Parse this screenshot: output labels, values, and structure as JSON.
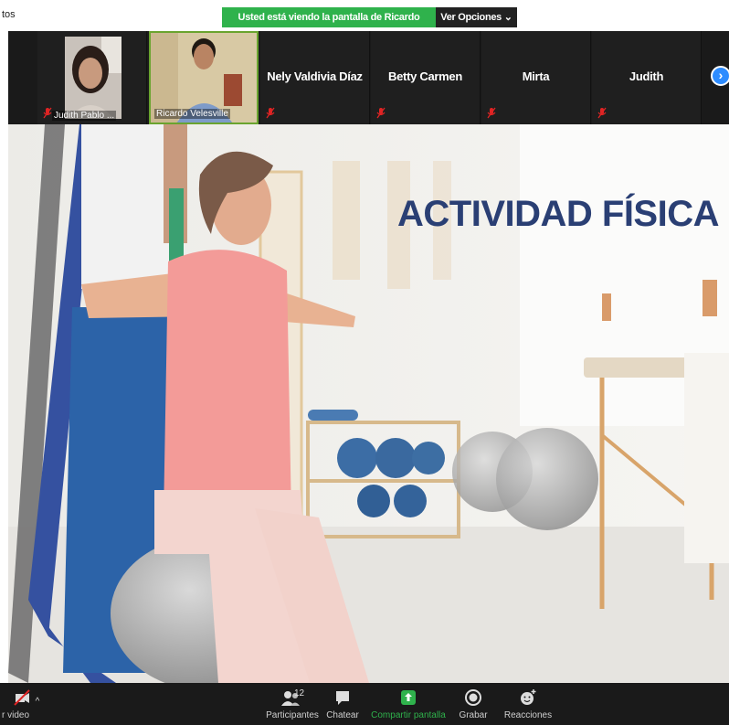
{
  "topbar": {
    "left_text": "tos",
    "share_banner": "Usted está viendo la pantalla de Ricardo Velesville",
    "options_button": "Ver Opciones ⌄"
  },
  "participants": [
    {
      "name": "Judith Pablo ...",
      "has_video": true,
      "muted": true
    },
    {
      "name": "Ricardo Velesville",
      "has_video": true,
      "muted": false,
      "active": true
    },
    {
      "name": "Nely Valdivia Díaz",
      "has_video": false,
      "muted": true
    },
    {
      "name": "Betty Carmen",
      "has_video": false,
      "muted": true
    },
    {
      "name": "Mirta",
      "has_video": false,
      "muted": true
    },
    {
      "name": "Judith",
      "has_video": false,
      "muted": true
    }
  ],
  "next_page_icon": "chevron-right-icon",
  "slide": {
    "title": "ACTIVIDAD FÍSICA"
  },
  "toolbar": {
    "video_label": "r video",
    "participants_label": "Participantes",
    "participants_count": "12",
    "chat_label": "Chatear",
    "share_label": "Compartir pantalla",
    "record_label": "Grabar",
    "reactions_label": "Reacciones"
  },
  "colors": {
    "share_green": "#2fb24c",
    "title_blue": "#2a3f74",
    "accent_blue": "#2d8cff",
    "mute_red": "#e02424"
  }
}
